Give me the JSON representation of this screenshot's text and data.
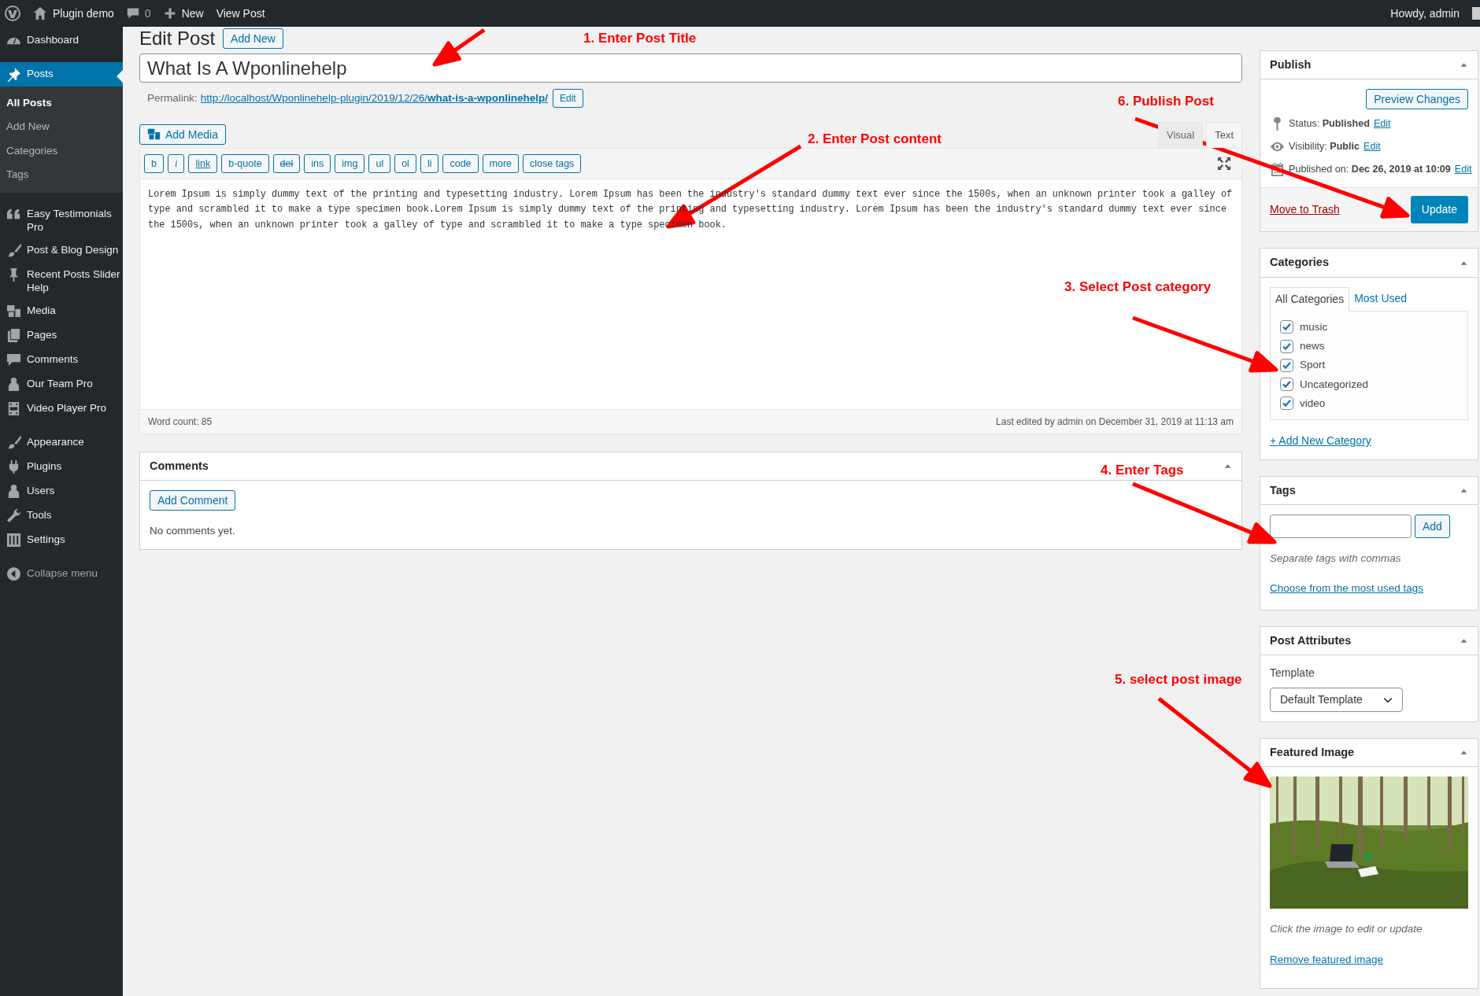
{
  "admin_bar": {
    "site": "Plugin demo",
    "comments": "0",
    "new": "New",
    "view": "View Post",
    "greeting": "Howdy, admin"
  },
  "sidebar": {
    "groups": [
      {
        "items": [
          {
            "label": "Dashboard",
            "selected": false
          }
        ]
      },
      {
        "items": [
          {
            "label": "Posts",
            "selected": true,
            "children": [
              {
                "label": "All Posts",
                "selected": true
              },
              {
                "label": "Add New",
                "selected": false
              },
              {
                "label": "Categories",
                "selected": false
              },
              {
                "label": "Tags",
                "selected": false
              }
            ]
          }
        ]
      },
      {
        "items": [
          {
            "label": "Easy Testimonials Pro",
            "selected": false
          },
          {
            "label": "Post & Blog Design",
            "selected": false
          },
          {
            "label": "Recent Posts Slider Help",
            "selected": false
          },
          {
            "label": "Media",
            "selected": false
          },
          {
            "label": "Pages",
            "selected": false
          },
          {
            "label": "Comments",
            "selected": false
          },
          {
            "label": "Our Team Pro",
            "selected": false
          },
          {
            "label": "Video Player Pro",
            "selected": false
          }
        ]
      },
      {
        "items": [
          {
            "label": "Appearance",
            "selected": false
          },
          {
            "label": "Plugins",
            "selected": false
          },
          {
            "label": "Users",
            "selected": false
          },
          {
            "label": "Tools",
            "selected": false
          },
          {
            "label": "Settings",
            "selected": false
          }
        ]
      }
    ],
    "collapse": "Collapse menu"
  },
  "page": {
    "heading": "Edit Post",
    "add_new": "Add New"
  },
  "editor": {
    "title": "What Is A Wponlinehelp",
    "permalink_label": "Permalink:",
    "permalink_base": "http://localhost/Wponlinehelp-plugin/2019/12/26/",
    "permalink_slug": "what-is-a-wponlinehelp/",
    "permalink_edit": "Edit",
    "add_media": "Add Media",
    "tabs": [
      {
        "label": "Visual",
        "selected": false
      },
      {
        "label": "Text",
        "selected": true
      }
    ],
    "quicktags": [
      {
        "label": "b",
        "kind": "plain"
      },
      {
        "label": "i",
        "kind": "italic"
      },
      {
        "label": "link",
        "kind": "underline"
      },
      {
        "label": "b-quote",
        "kind": "plain"
      },
      {
        "label": "del",
        "kind": "strike"
      },
      {
        "label": "ins",
        "kind": "plain"
      },
      {
        "label": "img",
        "kind": "plain"
      },
      {
        "label": "ul",
        "kind": "plain"
      },
      {
        "label": "ol",
        "kind": "plain"
      },
      {
        "label": "li",
        "kind": "plain"
      },
      {
        "label": "code",
        "kind": "plain"
      },
      {
        "label": "more",
        "kind": "plain"
      },
      {
        "label": "close tags",
        "kind": "plain"
      }
    ],
    "content": "Lorem Ipsum is simply dummy text of the printing and typesetting industry. Lorem Ipsum has been the industry's standard dummy text ever since the 1500s, when an unknown printer took a galley of type and scrambled it to make a type specimen book.Lorem Ipsum is simply dummy text of the printing and typesetting industry. Lorem Ipsum has been the industry's standard dummy text ever since the 1500s, when an unknown printer took a galley of type and scrambled it to make a type specimen book.",
    "word_count": "Word count: 85",
    "last_edited": "Last edited by admin on December 31, 2019 at 11:13 am"
  },
  "comments": {
    "title": "Comments",
    "add": "Add Comment",
    "empty": "No comments yet."
  },
  "publish": {
    "title": "Publish",
    "preview": "Preview Changes",
    "rows": [
      {
        "label": "Status: **Published**",
        "edit": "Edit"
      },
      {
        "label": "Visibility: **Public**",
        "edit": "Edit"
      },
      {
        "label": "Published on: **Dec 26, 2019 at 10:09**",
        "edit": "Edit"
      }
    ],
    "trash": "Move to Trash",
    "update": "Update"
  },
  "categories": {
    "title": "Categories",
    "tabs": [
      {
        "label": "All Categories",
        "selected": true
      },
      {
        "label": "Most Used",
        "selected": false
      }
    ],
    "items": [
      {
        "label": "music",
        "checked": true
      },
      {
        "label": "news",
        "checked": true
      },
      {
        "label": "Sport",
        "checked": true
      },
      {
        "label": "Uncategorized",
        "checked": true
      },
      {
        "label": "video",
        "checked": true
      }
    ],
    "add": "+ Add New Category"
  },
  "tags": {
    "title": "Tags",
    "add": "Add",
    "hint": "Separate tags with commas",
    "choose": "Choose from the most used tags"
  },
  "attributes": {
    "title": "Post Attributes",
    "template_label": "Template",
    "template": "Default Template"
  },
  "featured": {
    "title": "Featured Image",
    "hint": "Click the image to edit or update",
    "remove": "Remove featured image"
  },
  "annotations": [
    {
      "label": "1. Enter Post Title"
    },
    {
      "label": "6. Publish Post"
    },
    {
      "label": "2. Enter Post content"
    },
    {
      "label": "3. Select Post category"
    },
    {
      "label": "4. Enter Tags"
    },
    {
      "label": "5. select post image"
    }
  ]
}
